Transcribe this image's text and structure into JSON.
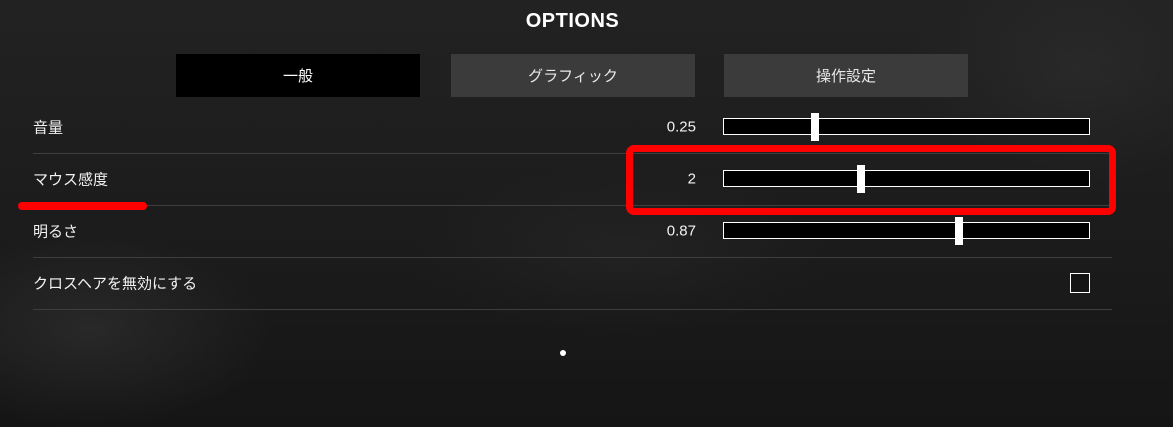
{
  "header": {
    "title": "OPTIONS"
  },
  "tabs": [
    {
      "label": "一般",
      "active": true
    },
    {
      "label": "グラフィック",
      "active": false
    },
    {
      "label": "操作設定",
      "active": false
    }
  ],
  "settings": [
    {
      "label": "音量",
      "value_text": "0.25",
      "fraction": 0.25
    },
    {
      "label": "マウス感度",
      "value_text": "2",
      "fraction": 0.375
    },
    {
      "label": "明るさ",
      "value_text": "0.87",
      "fraction": 0.645
    },
    {
      "label": "クロスヘアを無効にする",
      "checked": false
    }
  ],
  "annotations": {
    "highlight_color": "#ff0000"
  },
  "colors": {
    "tab_active_bg": "#000000",
    "tab_inactive_bg": "#3b3b3b",
    "slider_track": "#000000",
    "slider_border": "#ffffff"
  }
}
